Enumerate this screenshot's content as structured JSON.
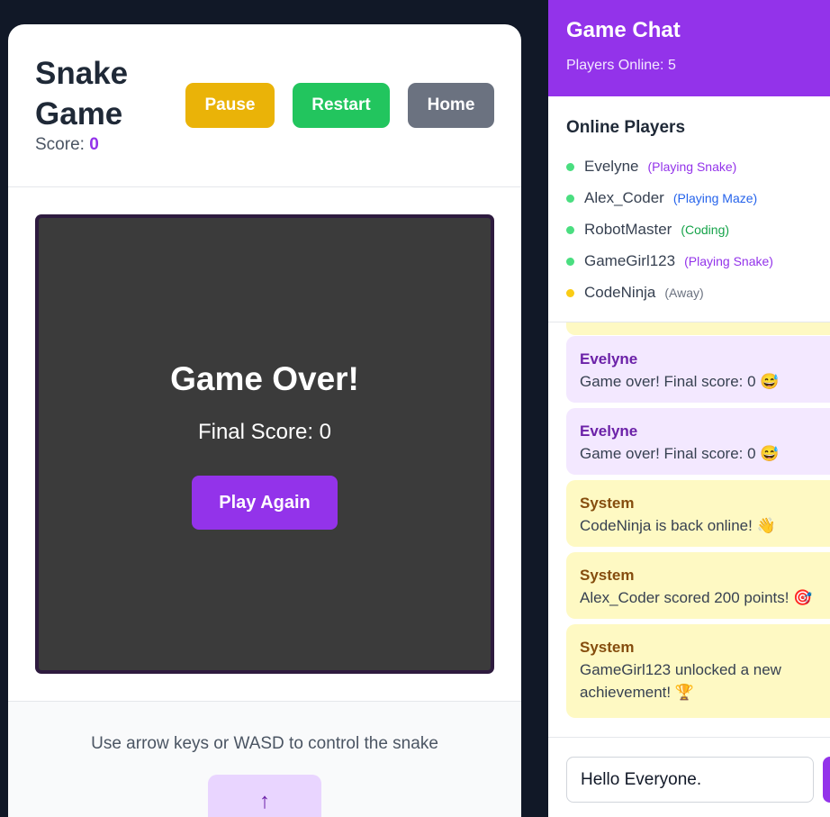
{
  "game": {
    "title": "Snake Game",
    "score_label": "Score:",
    "score_value": "0",
    "buttons": {
      "pause": "Pause",
      "restart": "Restart",
      "home": "Home"
    },
    "overlay": {
      "title": "Game Over!",
      "final_score": "Final Score: 0",
      "play_again": "Play Again"
    },
    "controls_hint": "Use arrow keys or WASD to control the snake",
    "control_up": "↑"
  },
  "chat": {
    "title": "Game Chat",
    "players_online": "Players Online: 5",
    "online_title": "Online Players",
    "players": [
      {
        "name": "Evelyne",
        "status": "(Playing Snake)",
        "status_color": "#9333ea",
        "dot_color": "#4ade80"
      },
      {
        "name": "Alex_Coder",
        "status": "(Playing Maze)",
        "status_color": "#2563eb",
        "dot_color": "#4ade80"
      },
      {
        "name": "RobotMaster",
        "status": "(Coding)",
        "status_color": "#16a34a",
        "dot_color": "#4ade80"
      },
      {
        "name": "GameGirl123",
        "status": "(Playing Snake)",
        "status_color": "#9333ea",
        "dot_color": "#4ade80"
      },
      {
        "name": "CodeNinja",
        "status": "(Away)",
        "status_color": "#6b7280",
        "dot_color": "#facc15"
      }
    ],
    "messages": [
      {
        "type": "user",
        "author": "Evelyne",
        "text": "Game over! Final score: 0 😅"
      },
      {
        "type": "user",
        "author": "Evelyne",
        "text": "Game over! Final score: 0 😅"
      },
      {
        "type": "sys",
        "author": "System",
        "text": "CodeNinja is back online! 👋"
      },
      {
        "type": "sys",
        "author": "System",
        "text": "Alex_Coder scored 200 points! 🎯"
      },
      {
        "type": "sys",
        "author": "System",
        "text": "GameGirl123 unlocked a new achievement! 🏆"
      }
    ],
    "input_value": "Hello Everyone."
  }
}
